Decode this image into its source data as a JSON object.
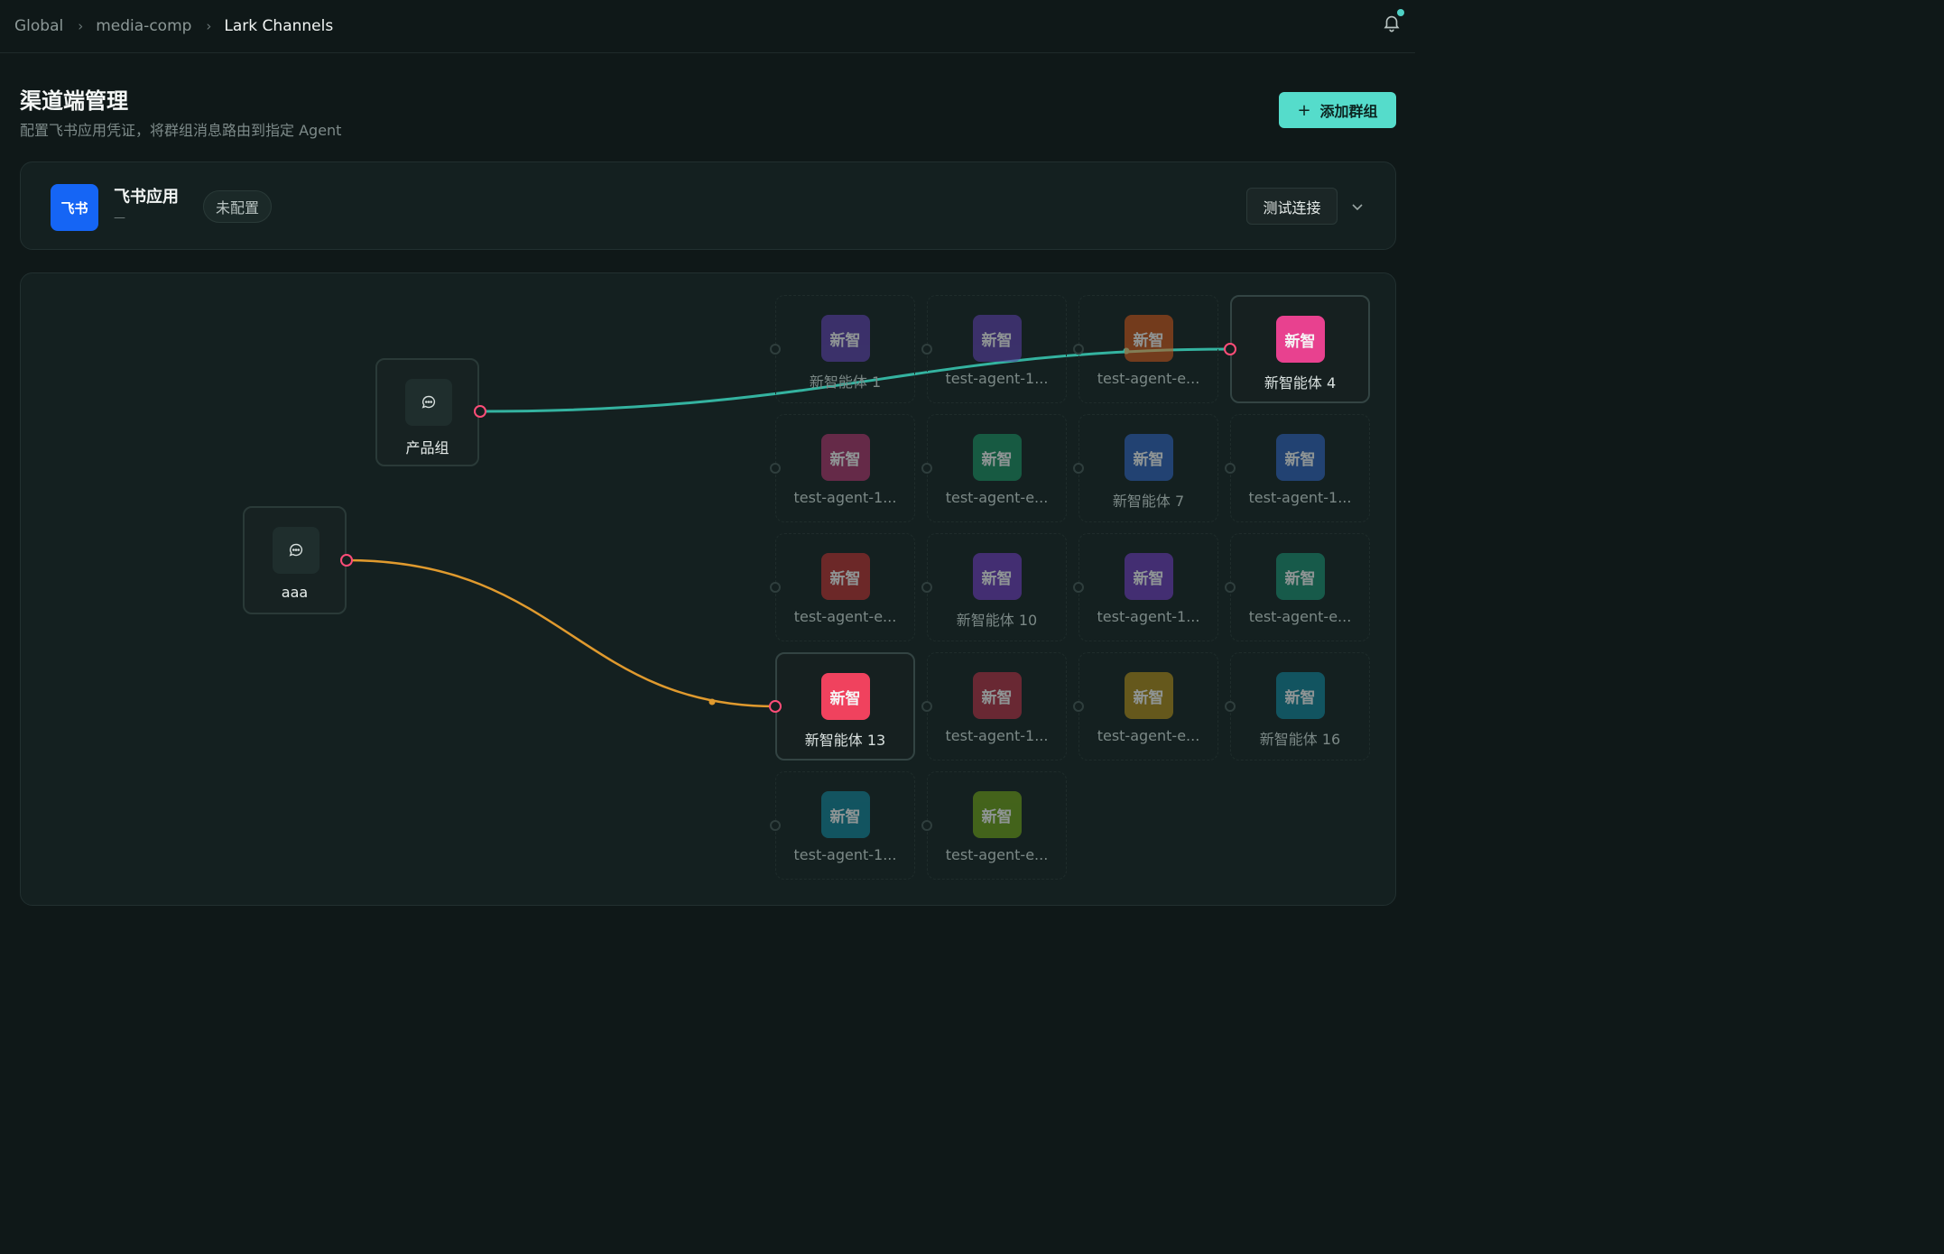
{
  "breadcrumb": [
    "Global",
    "media-comp",
    "Lark Channels"
  ],
  "header": {
    "title": "渠道端管理",
    "subtitle": "配置飞书应用凭证，将群组消息路由到指定 Agent",
    "add_group_label": "添加群组"
  },
  "app": {
    "logo_text": "飞书",
    "name": "飞书应用",
    "app_id": "—",
    "status": "未配置",
    "test_button": "测试连接"
  },
  "groups": [
    {
      "id": "g1",
      "name": "产品组",
      "edge_color": "#34b3a0"
    },
    {
      "id": "g2",
      "name": "aaa",
      "edge_color": "#e09a2e"
    }
  ],
  "agents": [
    {
      "avatar_text": "新智",
      "name": "新智能体 1",
      "color": "#5b3fa8",
      "connected": false
    },
    {
      "avatar_text": "新智",
      "name": "test-agent-1...",
      "color": "#5b3fa8",
      "connected": false
    },
    {
      "avatar_text": "新智",
      "name": "test-agent-e...",
      "color": "#c2531b",
      "connected": false
    },
    {
      "avatar_text": "新智",
      "name": "新智能体 4",
      "color": "#e8418f",
      "connected": true,
      "from_group": "g1"
    },
    {
      "avatar_text": "新智",
      "name": "test-agent-1...",
      "color": "#a8336a",
      "connected": false
    },
    {
      "avatar_text": "新智",
      "name": "test-agent-e...",
      "color": "#1a8a5e",
      "connected": false
    },
    {
      "avatar_text": "新智",
      "name": "新智能体 7",
      "color": "#2f5fb5",
      "connected": false
    },
    {
      "avatar_text": "新智",
      "name": "test-agent-1...",
      "color": "#2f5fb5",
      "connected": false
    },
    {
      "avatar_text": "新智",
      "name": "test-agent-e...",
      "color": "#b53030",
      "connected": false
    },
    {
      "avatar_text": "新智",
      "name": "新智能体 10",
      "color": "#6b3ab5",
      "connected": false
    },
    {
      "avatar_text": "新智",
      "name": "test-agent-1...",
      "color": "#6b3ab5",
      "connected": false
    },
    {
      "avatar_text": "新智",
      "name": "test-agent-e...",
      "color": "#1a8a6e",
      "connected": false
    },
    {
      "avatar_text": "新智",
      "name": "新智能体 13",
      "color": "#f0425e",
      "connected": true,
      "from_group": "g2"
    },
    {
      "avatar_text": "新智",
      "name": "test-agent-1...",
      "color": "#b02f44",
      "connected": false
    },
    {
      "avatar_text": "新智",
      "name": "test-agent-e...",
      "color": "#a8861a",
      "connected": false
    },
    {
      "avatar_text": "新智",
      "name": "新智能体 16",
      "color": "#127f96",
      "connected": false
    },
    {
      "avatar_text": "新智",
      "name": "test-agent-1...",
      "color": "#127f96",
      "connected": false
    },
    {
      "avatar_text": "新智",
      "name": "test-agent-e...",
      "color": "#6b9a18",
      "connected": false
    }
  ],
  "icons": {
    "notification": "bell-icon",
    "add": "plus-icon",
    "expand": "chevron-down-icon",
    "group": "chat-bubble-icon"
  },
  "colors": {
    "accent": "#55dccb",
    "lark_blue": "#1565f5",
    "handle_active": "#ff4d78"
  }
}
